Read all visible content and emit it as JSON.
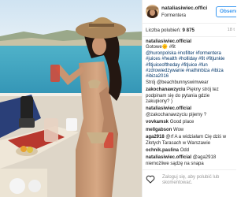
{
  "post": {
    "username": "nataliasiwiec.offici",
    "location": "Formentera",
    "follow_label": "Obserw",
    "likes_label": "Liczba polubień:",
    "likes_count": "9 875",
    "age": "18 t"
  },
  "caption": {
    "author": "nataliasiwiec.official",
    "lines": [
      "Gotowe🌞 #fit",
      "@huronpolska #nofilter #formentera",
      "#juices #health #holliday #fit #fitjunkie",
      "#fitjuiceoftheday #fitjuice #fun",
      "#zdrowiedzywanie #nathinbiza #ibiza",
      "#ibiza2016"
    ],
    "tail": "Strój @beachbunnyswimwear"
  },
  "comments": [
    {
      "user": "zakochanawzyciu",
      "text": "Piękny strój tez podpinam się do pytania gdzie zakupiony? )"
    },
    {
      "user": "nataliasiwiec.official",
      "text": "@zakochanawzyciu pijemy ?"
    },
    {
      "user": "vovkamsk",
      "text": "Good place"
    },
    {
      "user": "mellgabson",
      "text": "Wow"
    },
    {
      "user": "aga2918",
      "text": "@rf A a widziałam Cię dziś w Złotych Tarasach w Warszawie"
    },
    {
      "user": "ochnik.paulina",
      "text": "Odd"
    },
    {
      "user": "nataliasiwiec.official",
      "text": "@aga2918 niemożliwe  sądzę na snapa"
    }
  ],
  "composer": {
    "placeholder": "Zaloguj się, aby polubić lub skomentować."
  },
  "colors": {
    "link": "#003569",
    "follow": "#3897f0",
    "muted": "#999999"
  }
}
